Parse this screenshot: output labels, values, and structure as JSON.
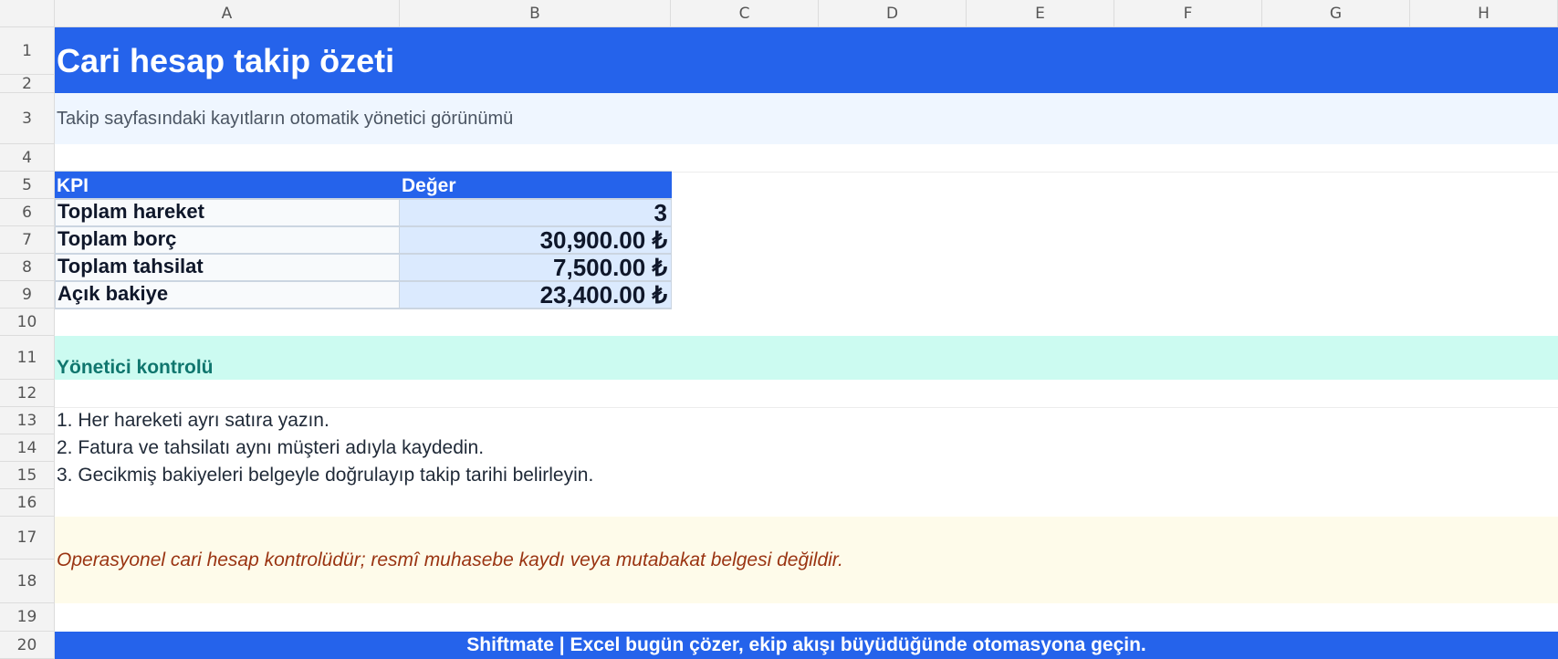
{
  "columns": [
    "A",
    "B",
    "C",
    "D",
    "E",
    "F",
    "G",
    "H"
  ],
  "rows": [
    "1",
    "2",
    "3",
    "4",
    "5",
    "6",
    "7",
    "8",
    "9",
    "10",
    "11",
    "12",
    "13",
    "14",
    "15",
    "16",
    "17",
    "18",
    "19",
    "20"
  ],
  "title": "Cari hesap takip özeti",
  "subtitle": "Takip sayfasındaki kayıtların otomatik yönetici görünümü",
  "kpi_table": {
    "header_label": "KPI",
    "header_value": "Değer",
    "rows": [
      {
        "label": "Toplam hareket",
        "value": "3"
      },
      {
        "label": "Toplam borç",
        "value": "30,900.00 ₺"
      },
      {
        "label": "Toplam tahsilat",
        "value": "7,500.00 ₺"
      },
      {
        "label": "Açık bakiye",
        "value": "23,400.00 ₺"
      }
    ]
  },
  "control_section": {
    "heading": "Yönetici kontrolü",
    "steps": [
      "1. Her hareketi ayrı satıra yazın.",
      "2. Fatura ve tahsilatı aynı müşteri adıyla kaydedin.",
      "3. Gecikmiş bakiyeleri belgeyle doğrulayıp takip tarihi belirleyin."
    ]
  },
  "disclaimer": "Operasyonel cari hesap kontrolüdür; resmî muhasebe kaydı veya mutabakat belgesi değildir.",
  "footer": "Shiftmate | Excel bugün çözer, ekip akışı büyüdüğünde otomasyona geçin.",
  "colors": {
    "brand_blue": "#2563eb",
    "subtitle_bg": "#eff6ff",
    "section_bg": "#ccfbf1",
    "section_text": "#0f766e",
    "note_bg": "#fefbea",
    "note_text": "#9a3412",
    "kpi_value_bg": "#dbeafe"
  }
}
